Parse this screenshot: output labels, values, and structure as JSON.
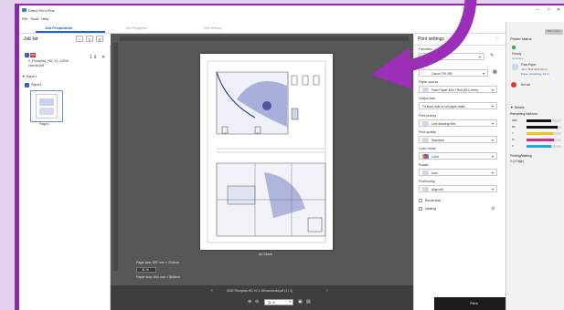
{
  "window": {
    "title": "Direct Print Plus"
  },
  "menu": [
    "File",
    "Tools",
    "Help"
  ],
  "tabs": [
    {
      "label": "Job Preparation",
      "active": true
    },
    {
      "label": "Job Progress",
      "active": false
    },
    {
      "label": "Job History",
      "active": false
    }
  ],
  "job_list": {
    "title": "Job list",
    "file_label": "2_Floorplan_HD_V1_1GRe...",
    "file_ext": "ckerdd.pdf",
    "group_label": "Paper1",
    "item_label": "Page1"
  },
  "preview": {
    "page_size": "Page size: 297 mm × 210mm",
    "paper_size": "Paper size: 841 mm × 594mm",
    "doc_name": "0002 Floorplan-HD V1.1-DRoeckerdd.pdf (1 / 1)",
    "zoom": "31 %",
    "sheet_label": "A0 Sheet"
  },
  "settings": {
    "title": "Print settings",
    "fields": [
      {
        "label": "Favorites",
        "value": ""
      },
      {
        "label": "Printer",
        "value": "Canon TM-355"
      },
      {
        "label": "Paper source",
        "value": "Plain Paper 42in / Roll (841.0mm)"
      },
      {
        "label": "Output size",
        "value": "Fit short side to roll paper width"
      },
      {
        "label": "Print priority",
        "value": "Line drawing/Text"
      },
      {
        "label": "Print quality",
        "value": "Standard"
      },
      {
        "label": "Color mode",
        "value": "Color"
      },
      {
        "label": "Rotate",
        "value": "Auto"
      },
      {
        "label": "Positioning",
        "value": "Align left"
      }
    ],
    "checks": [
      "Borderless",
      "Nesting"
    ],
    "print_button": "Print"
  },
  "status": {
    "title": "Printer status",
    "sub_button": "Click to print",
    "ready": "Ready",
    "ready_sub": "Complete",
    "paper_label": "Plain Paper",
    "paper_value": "42in / Roll (841.0mm)",
    "paper_remaining": "Paper remaining: 24 m",
    "not_set": "Not set",
    "details": "Details",
    "ink_title": "Remaining ink/toner",
    "inks": [
      {
        "name": "MBK",
        "color": "#111111",
        "fraction": 0.72
      },
      {
        "name": "BK",
        "color": "#111111",
        "fraction": 0.9
      },
      {
        "name": "Y",
        "color": "#f0c419",
        "fraction": 0.75
      },
      {
        "name": "M",
        "color": "#d0268d",
        "fraction": 0.8
      },
      {
        "name": "C",
        "color": "#23a9e1",
        "fraction": 0.7
      }
    ],
    "waiting_title": "Printing/Waiting",
    "waiting_value": "0 (0 Page)"
  },
  "colors": {
    "accent": "#2563c9",
    "frame": "#8a2aa6",
    "arrow": "#9b2fb8"
  }
}
